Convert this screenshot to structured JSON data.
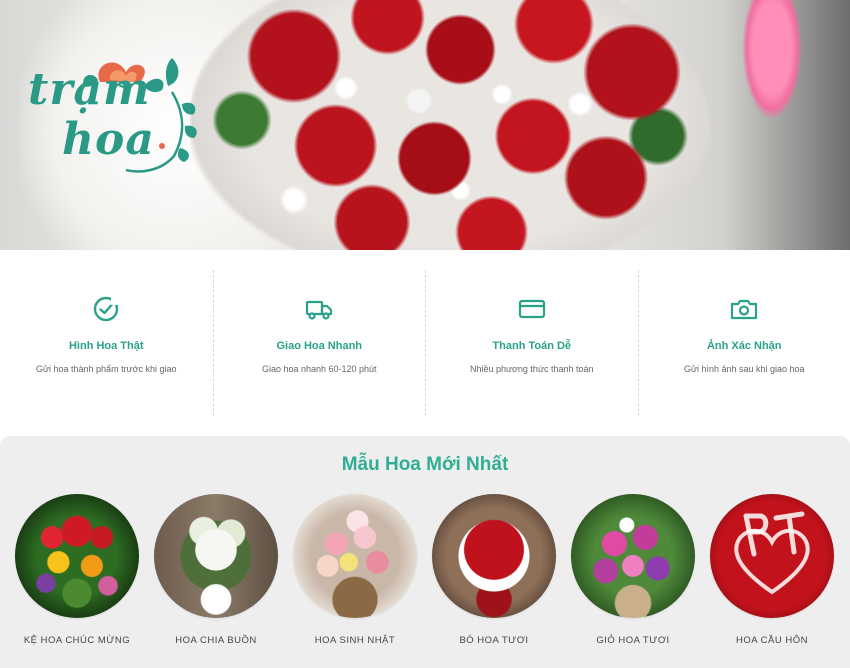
{
  "brand": {
    "logo_line1": "trạm",
    "logo_line2": "hoa"
  },
  "colors": {
    "accent": "#2aa289",
    "title": "#2fae93",
    "hero_rose": "#b3111c"
  },
  "features": [
    {
      "icon": "check-circle-icon",
      "title": "Hình Hoa Thật",
      "desc": "Gửi hoa thành phẩm trước khi giao"
    },
    {
      "icon": "truck-icon",
      "title": "Giao Hoa Nhanh",
      "desc": "Giao hoa nhanh 60-120 phút"
    },
    {
      "icon": "credit-card-icon",
      "title": "Thanh Toán Dễ",
      "desc": "Nhiều phương thức thanh toán"
    },
    {
      "icon": "camera-icon",
      "title": "Ảnh Xác Nhận",
      "desc": "Gửi hình ảnh sau khi giao hoa"
    }
  ],
  "products_section": {
    "title": "Mẫu Hoa Mới Nhất",
    "items": [
      {
        "label": "KỆ HOA CHÚC MỪNG"
      },
      {
        "label": "HOA CHIA BUỒN"
      },
      {
        "label": "HOA SINH NHẬT"
      },
      {
        "label": "BÓ HOA TƯƠI"
      },
      {
        "label": "GIỎ HOA TƯƠI"
      },
      {
        "label": "HOA CẦU HÔN"
      }
    ]
  }
}
